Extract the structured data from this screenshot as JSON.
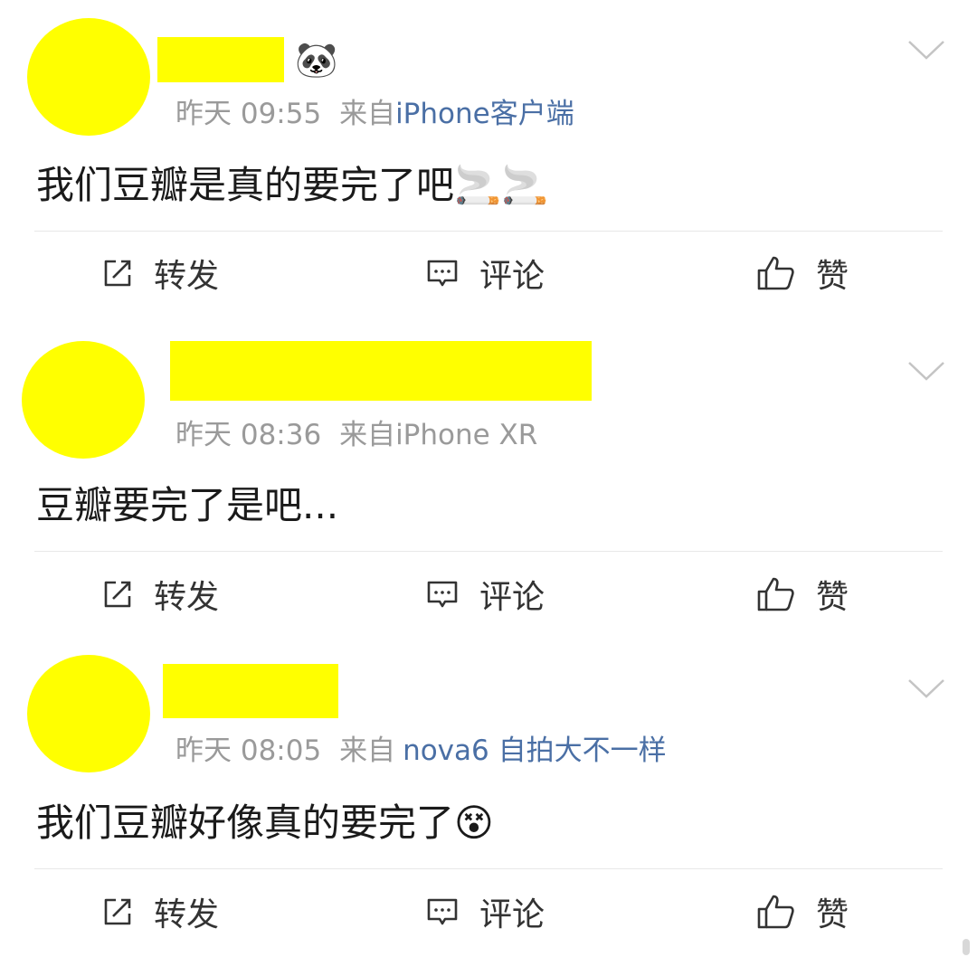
{
  "posts": [
    {
      "time": "昨天 09:55",
      "from_prefix": "来自",
      "source": "iPhone客户端",
      "name_emoji": "🐼",
      "content": "我们豆瓣是真的要完了吧🚬🚬"
    },
    {
      "time": "昨天 08:36",
      "from_prefix": "来自",
      "source": "iPhone XR",
      "name_emoji": "",
      "content": "豆瓣要完了是吧..."
    },
    {
      "time": "昨天 08:05",
      "from_prefix": "来自",
      "source": "nova6 自拍大不一样",
      "name_emoji": "",
      "content": "我们豆瓣好像真的要完了😵"
    }
  ],
  "actions": {
    "repost": "转发",
    "comment": "评论",
    "like": "赞"
  },
  "icons": {
    "repost": "repost-icon",
    "comment": "comment-icon",
    "like": "thumbs-up-icon",
    "menu": "chevron-down-icon"
  },
  "colors": {
    "redaction": "#ffff00",
    "meta_text": "#9a9a9a",
    "source_link": "#4a6fa5",
    "divider": "#e8e8e8"
  }
}
